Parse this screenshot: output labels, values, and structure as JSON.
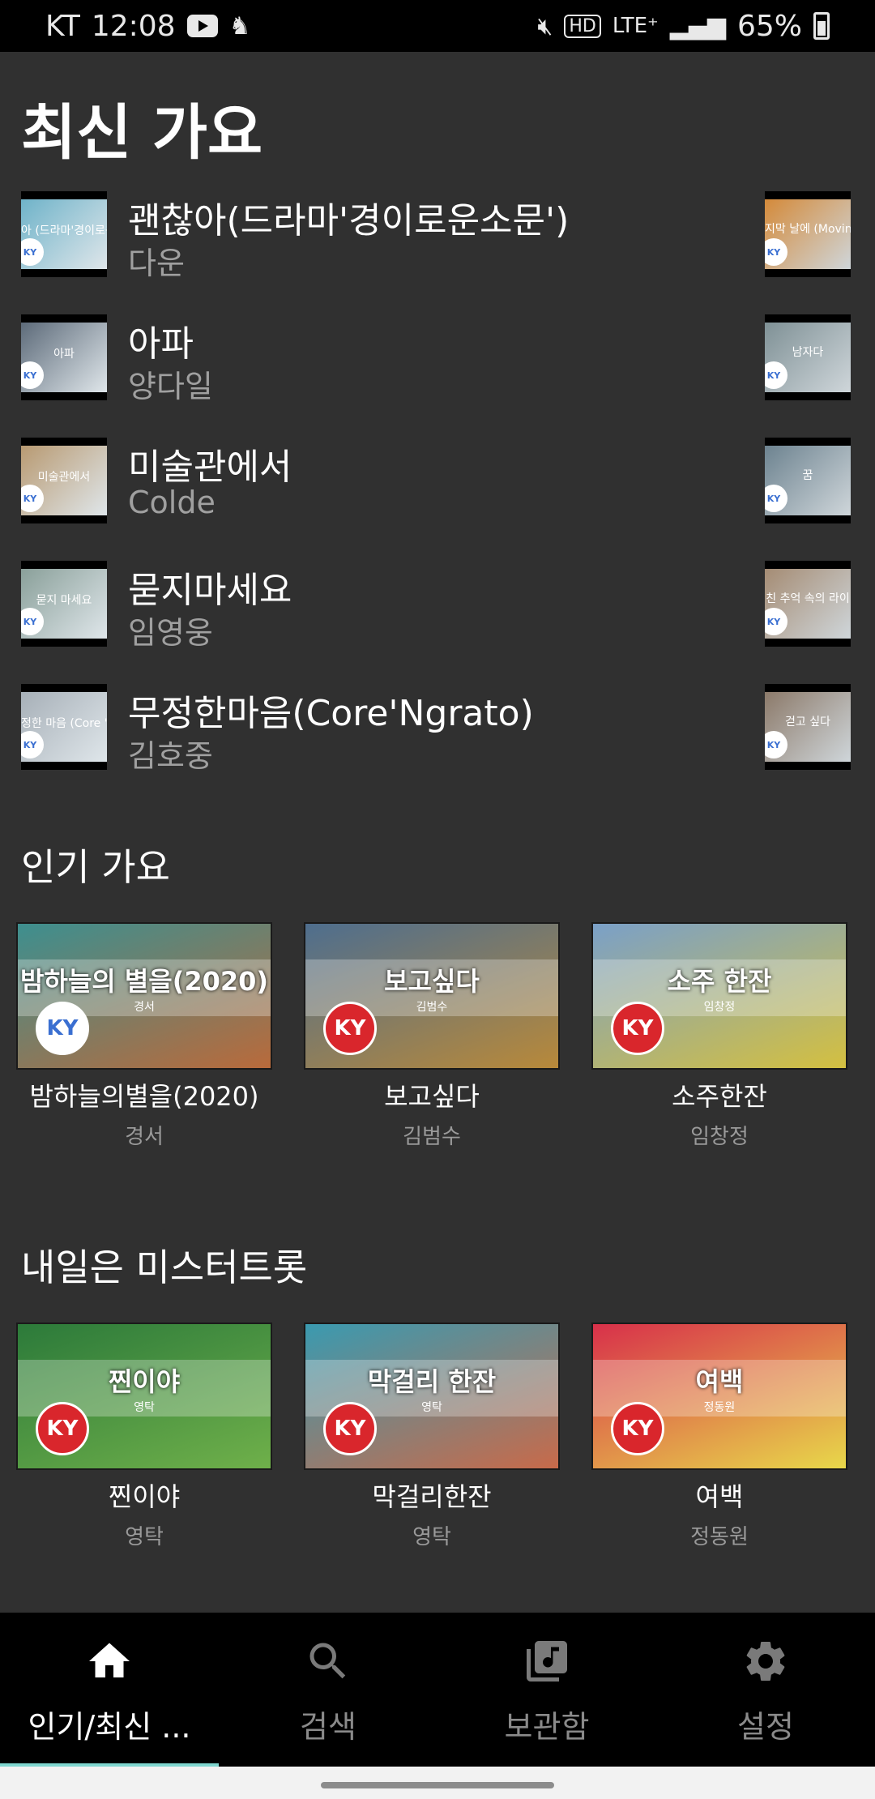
{
  "status_bar": {
    "carrier": "KT",
    "time": "12:08",
    "network": "LTE⁺",
    "battery": "65%"
  },
  "sections": {
    "recent_title": "최신 가요",
    "popular_title": "인기 가요",
    "trot_title": "내일은 미스터트롯"
  },
  "recent": [
    {
      "title": "괜찮아(드라마'경이로운소문')",
      "artist": "다운",
      "thumb_caption": "아 (드라마'경이로운 소",
      "right_caption": "지막 날에 (Moving C",
      "thumb_color": "#6fb3c9",
      "right_color": "#d48a3a"
    },
    {
      "title": "아파",
      "artist": "양다일",
      "thumb_caption": "아파",
      "right_caption": "남자다",
      "thumb_color": "#5d6b7a",
      "right_color": "#7f9196"
    },
    {
      "title": "미술관에서",
      "artist": "Colde",
      "thumb_caption": "미술관에서",
      "right_caption": "꿈",
      "thumb_color": "#b89a72",
      "right_color": "#6d8390"
    },
    {
      "title": "묻지마세요",
      "artist": "임영웅",
      "thumb_caption": "묻지 마세요",
      "right_caption": "친 추억 속의 라이",
      "thumb_color": "#8aa09a",
      "right_color": "#a58c74"
    },
    {
      "title": "무정한마음(Core'Ngrato)",
      "artist": "김호중",
      "thumb_caption": "정한 마음 (Core 'Ngra",
      "right_caption": "걷고 싶다",
      "thumb_color": "#a7b0b8",
      "right_color": "#8c7a6a"
    }
  ],
  "ky_label": "KY",
  "popular": [
    {
      "title": "밤하늘의별을(2020)",
      "artist": "경서",
      "overlay": "밤하늘의 별을(2020)",
      "overlay_sub": "경서",
      "bg": "#3d8f8f",
      "bg2": "#b96a3b",
      "badge": "white"
    },
    {
      "title": "보고싶다",
      "artist": "김범수",
      "overlay": "보고싶다",
      "overlay_sub": "김범수",
      "bg": "#4e6e8e",
      "bg2": "#b8893a",
      "badge": "red"
    },
    {
      "title": "소주한잔",
      "artist": "임창정",
      "overlay": "소주 한잔",
      "overlay_sub": "임창정",
      "bg": "#7aa0c8",
      "bg2": "#d4c040",
      "badge": "red"
    }
  ],
  "trot": [
    {
      "title": "찐이야",
      "artist": "영탁",
      "overlay": "찐이야",
      "overlay_sub": "영탁",
      "bg": "#2c7a3a",
      "bg2": "#6fb04a",
      "badge": "red"
    },
    {
      "title": "막걸리한잔",
      "artist": "영탁",
      "overlay": "막걸리 한잔",
      "overlay_sub": "영탁",
      "bg": "#3a9ab0",
      "bg2": "#c86a4a",
      "badge": "red"
    },
    {
      "title": "여백",
      "artist": "정동원",
      "overlay": "여백",
      "overlay_sub": "정동원",
      "bg": "#d8304a",
      "bg2": "#e8d84a",
      "badge": "red"
    }
  ],
  "nav": [
    {
      "label": "인기/최신 ...",
      "icon": "home-icon",
      "active": true
    },
    {
      "label": "검색",
      "icon": "search-icon",
      "active": false
    },
    {
      "label": "보관함",
      "icon": "library-music-icon",
      "active": false
    },
    {
      "label": "설정",
      "icon": "settings-icon",
      "active": false
    }
  ],
  "colors": {
    "background": "#303030",
    "accent": "#7fd6cf",
    "nav_bg": "#000000"
  }
}
